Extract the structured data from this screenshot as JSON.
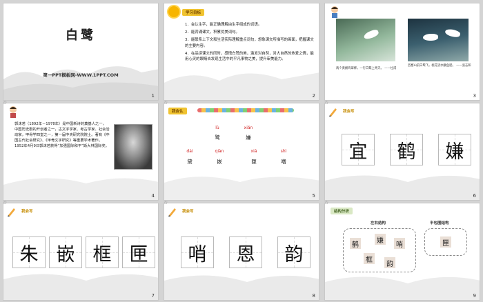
{
  "slides": {
    "s1": {
      "title": "白鹭",
      "subtitle": "第一PPT模板网-WWW.1PPT.COM",
      "num": "1"
    },
    "s2": {
      "tag": "学习目标",
      "num": "2",
      "goals": [
        "1．会认生字，能正确理解由生字组成的词语。",
        "2．能背诵课文，积累优美词句。",
        "3．能联系上下文和生活实际理解重点词句，想象课文所描写的画面，把握课文的主要内容。",
        "4．在品读课文的同时，感悟白鹭的美，激发对自然，对大自然的热爱之情，能用心灵的眼睛去发现生活中的平凡事物之美，提升审美能力。"
      ]
    },
    "s3": {
      "num": "3",
      "caption_left": "两个黄鹂鸣翠柳，一行白鹭上青天。 ——杜甫",
      "caption_right": "西塞山前白鹭飞，桃花流水鳜鱼肥。 ——张志和"
    },
    "s4": {
      "num": "4",
      "bio": "郭沫若（1892年－1978年）是中国新诗的奠基人之一，中国历史剧的开创者之一，古文字学家、考古学家、社会活动家，甲骨学四堂之一，第一届中央研究院院士。著有《中国古代社会研究》、《甲骨文字研究》等重要学术著作。1952年4月9日郭沫若获得“加强国际和平”斯大林国际奖。"
    },
    "s5": {
      "num": "5",
      "tag": "我会认",
      "row1": [
        {
          "py": "lù",
          "hz": "鹭"
        },
        {
          "py": "xián",
          "hz": "嫌"
        }
      ],
      "row2": [
        {
          "py": "dài",
          "hz": "黛"
        },
        {
          "py": "qiàn",
          "hz": "嵌"
        },
        {
          "py": "xiá",
          "hz": "匣"
        },
        {
          "py": "shì",
          "hz": "嗜"
        }
      ]
    },
    "s6": {
      "num": "6",
      "tag": "我会写",
      "chars": [
        "宜",
        "鹤",
        "嫌"
      ]
    },
    "s7": {
      "num": "7",
      "tag": "我会写",
      "chars": [
        "朱",
        "嵌",
        "框",
        "匣"
      ]
    },
    "s8": {
      "num": "8",
      "tag": "我会写",
      "chars": [
        "哨",
        "恩",
        "韵"
      ]
    },
    "s9": {
      "num": "9",
      "tag": "结构分析",
      "label_lr": "左右结构",
      "label_semi": "半包围结构",
      "lr_chars": [
        "鹤",
        "嫌",
        "哨",
        "框",
        "韵"
      ],
      "semi_chars": [
        "匣"
      ]
    }
  },
  "gap_marks": [
    "☆",
    "☆",
    "☆",
    "☆",
    "☆",
    "☆"
  ],
  "colors": {
    "tag": "#f0c330",
    "pinyin": "#d02020"
  }
}
